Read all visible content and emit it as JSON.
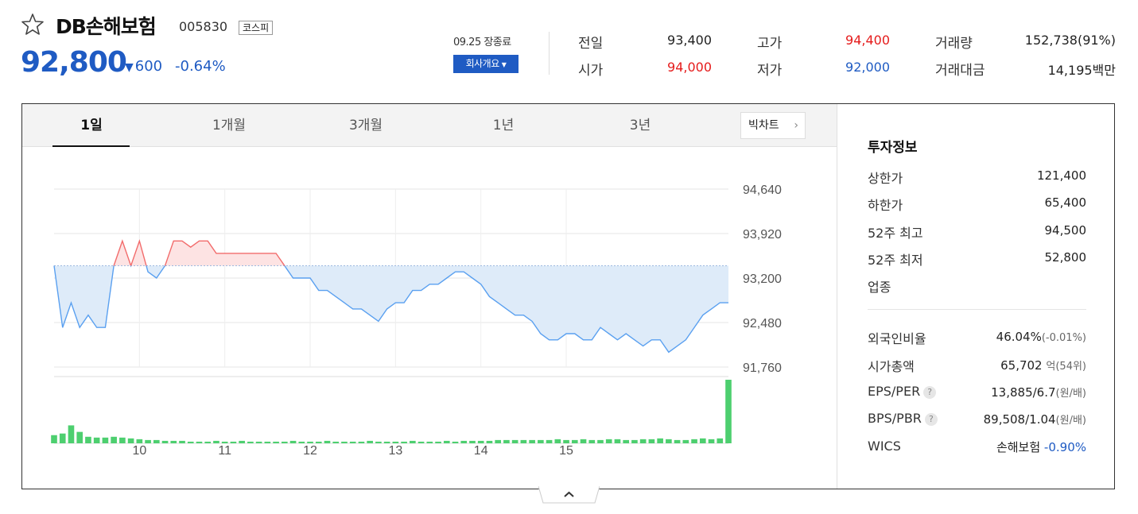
{
  "stock": {
    "name": "DB손해보험",
    "code": "005830",
    "market": "코스피",
    "price": "92,800",
    "change": "600",
    "change_rate": "-0.64%",
    "direction_icon": "triangle-down-icon",
    "favorite_icon": "star-outline-icon"
  },
  "session": {
    "status": "09.25 장종료",
    "company_button": "회사개요",
    "caret_icon": "caret-down-icon"
  },
  "quote": {
    "prev_close_label": "전일",
    "prev_close": "93,400",
    "open_label": "시가",
    "open": "94,000",
    "high_label": "고가",
    "high": "94,400",
    "low_label": "저가",
    "low": "92,000",
    "volume_label": "거래량",
    "volume": "152,738(91%)",
    "amount_label": "거래대금",
    "amount": "14,195백만"
  },
  "tabs": [
    "1일",
    "1개월",
    "3개월",
    "1년",
    "3년"
  ],
  "active_tab": 0,
  "bigchart": {
    "label": "빅차트",
    "icon": "chevron-right-icon"
  },
  "colors": {
    "up": "#e51b1b",
    "down": "#1f5bc3",
    "line_up": "#f26b6b",
    "line_down": "#5aa0f0",
    "fill_up": "#fde3e3",
    "fill_down": "#deebf9",
    "volume": "#4dcf6f"
  },
  "chart_data": {
    "type": "line",
    "reference_price": 93400,
    "ylim": [
      91760,
      94640
    ],
    "y_ticks": [
      "94,640",
      "93,920",
      "93,200",
      "92,480",
      "91,760"
    ],
    "x_ticks": [
      "10",
      "11",
      "12",
      "13",
      "14",
      "15"
    ],
    "x_tick_index": [
      10,
      20,
      30,
      40,
      50,
      60
    ],
    "price": [
      93400,
      92400,
      92800,
      92400,
      92600,
      92400,
      92400,
      93400,
      93800,
      93400,
      93800,
      93300,
      93200,
      93400,
      93800,
      93800,
      93700,
      93800,
      93800,
      93600,
      93600,
      93600,
      93600,
      93600,
      93600,
      93600,
      93600,
      93400,
      93200,
      93200,
      93200,
      93000,
      93000,
      92900,
      92800,
      92700,
      92700,
      92600,
      92500,
      92700,
      92800,
      92800,
      93000,
      93000,
      93100,
      93100,
      93200,
      93300,
      93300,
      93200,
      93100,
      92900,
      92800,
      92700,
      92600,
      92600,
      92500,
      92300,
      92200,
      92200,
      92300,
      92300,
      92200,
      92200,
      92400,
      92300,
      92200,
      92300,
      92200,
      92100,
      92200,
      92200,
      92000,
      92100,
      92200,
      92400,
      92600,
      92700,
      92800,
      92800
    ],
    "volume": [
      10,
      12,
      22,
      14,
      8,
      7,
      7,
      8,
      7,
      6,
      5,
      4,
      4,
      3,
      3,
      3,
      2,
      2,
      2,
      3,
      2,
      2,
      3,
      2,
      2,
      2,
      2,
      2,
      3,
      2,
      2,
      2,
      3,
      2,
      2,
      2,
      2,
      3,
      2,
      2,
      2,
      2,
      3,
      2,
      2,
      2,
      3,
      2,
      3,
      3,
      3,
      3,
      4,
      4,
      4,
      4,
      4,
      4,
      4,
      5,
      4,
      4,
      5,
      4,
      4,
      5,
      5,
      4,
      4,
      5,
      5,
      6,
      5,
      4,
      4,
      5,
      6,
      5,
      6,
      78
    ]
  },
  "invest": {
    "title": "투자정보",
    "upper_label": "상한가",
    "upper": "121,400",
    "lower_label": "하한가",
    "lower": "65,400",
    "high52_label": "52주 최고",
    "high52": "94,500",
    "low52_label": "52주 최저",
    "low52": "52,800",
    "industry_label": "업종",
    "foreign_label": "외국인비율",
    "foreign": "46.04%",
    "foreign_change": "(-0.01%)",
    "mcap_label": "시가총액",
    "mcap": "65,702",
    "mcap_unit": "억(54위)",
    "eps_label": "EPS/PER",
    "eps": "13,885/6.7",
    "eps_unit": "(원/배)",
    "bps_label": "BPS/PBR",
    "bps": "89,508/1.04",
    "bps_unit": "(원/배)",
    "wics_label": "WICS",
    "wics": "손해보험",
    "wics_rate": "-0.90%",
    "help_icon": "question-icon"
  },
  "collapse_icon": "chevron-up-icon"
}
